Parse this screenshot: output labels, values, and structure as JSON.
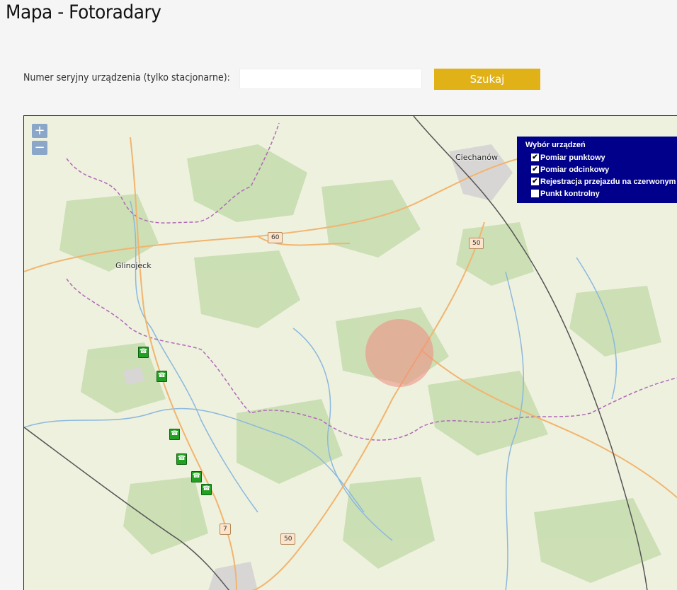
{
  "page": {
    "title": "Mapa - Fotoradary"
  },
  "search": {
    "label": "Numer seryjny urządzenia (tylko stacjonarne):",
    "value": "",
    "placeholder": "",
    "button_label": "Szukaj",
    "button_color": "#e1b118"
  },
  "map": {
    "zoom_in_label": "+",
    "zoom_out_label": "−",
    "towns": [
      "Ciechanów",
      "Glinojeck"
    ],
    "road_numbers": [
      "60",
      "50",
      "7",
      "50"
    ],
    "highlight_color": "#f08a80",
    "device_icon": "speed-camera-icon",
    "device_marker_color": "#22a022",
    "device_marker_count": 6
  },
  "legend": {
    "title": "Wybór urządzeń",
    "background": "#00008b",
    "items": [
      {
        "label": "Pomiar punktowy",
        "checked": true
      },
      {
        "label": "Pomiar odcinkowy",
        "checked": true
      },
      {
        "label": "Rejestracja przejazdu na czerwonym świetle",
        "checked": true
      },
      {
        "label": "Punkt kontrolny",
        "checked": false
      }
    ]
  }
}
